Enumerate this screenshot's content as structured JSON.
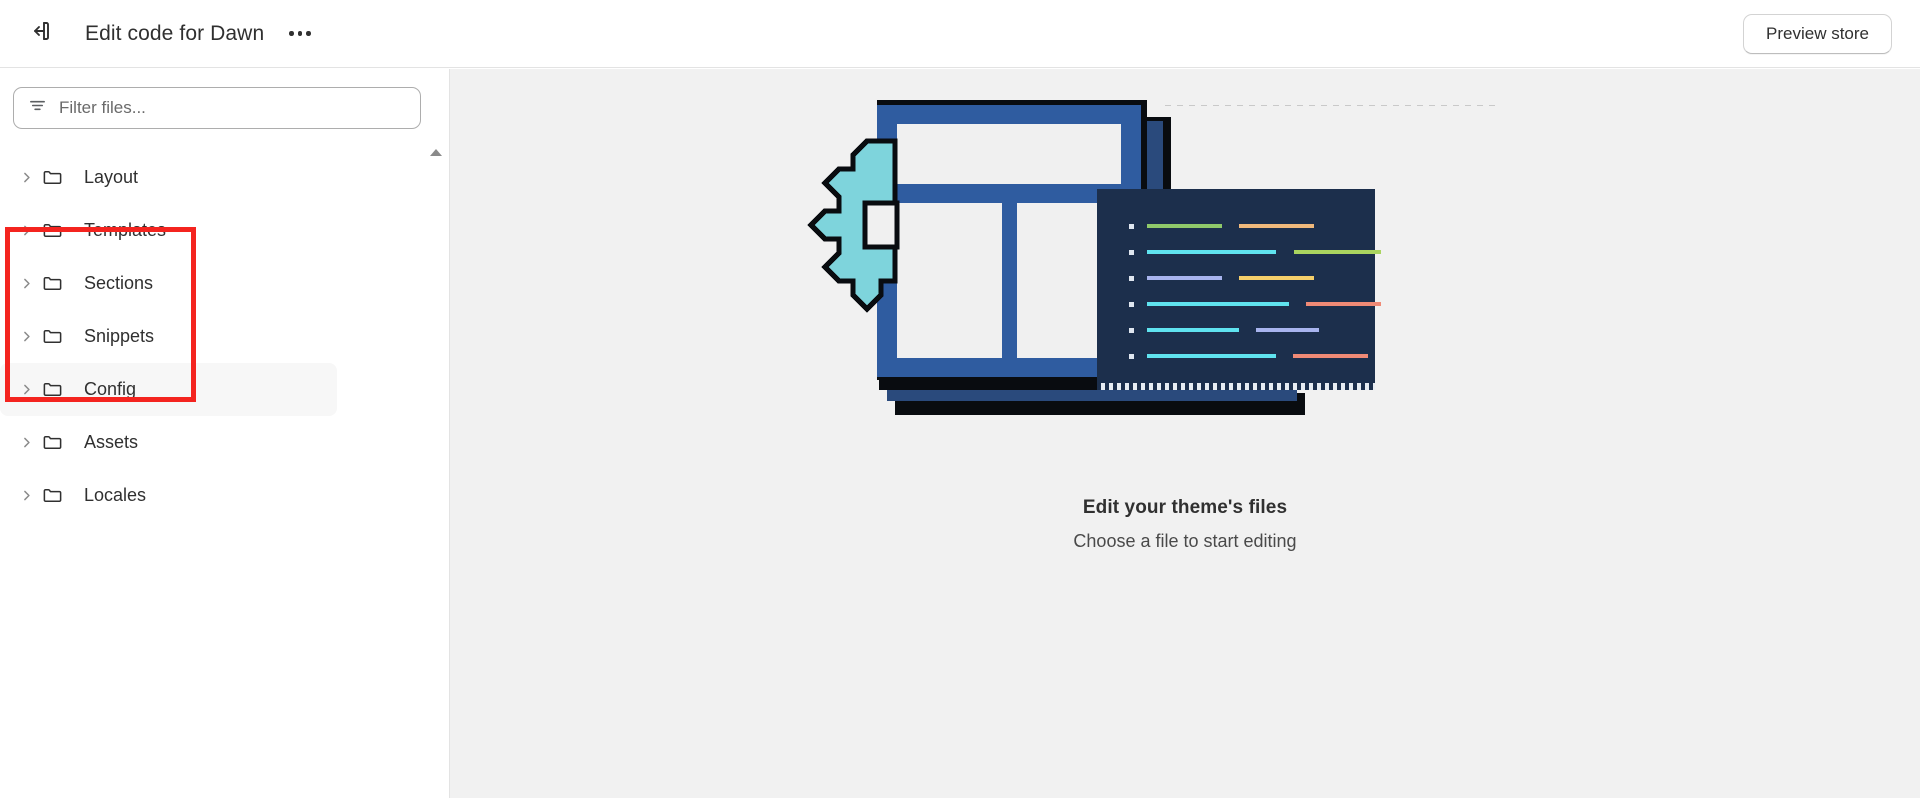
{
  "header": {
    "exit_icon": "exit-icon",
    "title": "Edit code for Dawn",
    "more_menu_icon": "ellipsis-icon",
    "preview_button": "Preview store"
  },
  "sidebar": {
    "filter": {
      "icon": "filter-icon",
      "value": "",
      "placeholder": "Filter files..."
    },
    "scrollbar_up_icon": "scroll-up-arrow-icon",
    "tree": [
      {
        "label": "Layout",
        "chevron": "chevron-right-icon",
        "icon": "folder-icon",
        "hovered": false
      },
      {
        "label": "Templates",
        "chevron": "chevron-right-icon",
        "icon": "folder-icon",
        "hovered": false
      },
      {
        "label": "Sections",
        "chevron": "chevron-right-icon",
        "icon": "folder-icon",
        "hovered": false
      },
      {
        "label": "Snippets",
        "chevron": "chevron-right-icon",
        "icon": "folder-icon",
        "hovered": false
      },
      {
        "label": "Config",
        "chevron": "chevron-right-icon",
        "icon": "folder-icon",
        "hovered": true
      },
      {
        "label": "Assets",
        "chevron": "chevron-right-icon",
        "icon": "folder-icon",
        "hovered": false
      },
      {
        "label": "Locales",
        "chevron": "chevron-right-icon",
        "icon": "folder-icon",
        "hovered": false
      }
    ]
  },
  "annotation": {
    "shape": "rectangle",
    "color": "#f4241f"
  },
  "main": {
    "illustration": "theme-files-illustration",
    "empty_state_title": "Edit your theme's files",
    "empty_state_subtitle": "Choose a file to start editing",
    "illustration_colors": {
      "window_blue": "#2f5ca0",
      "window_blue_dark": "#2a4a7c",
      "outline_black": "#090c10",
      "code_panel_navy": "#1c2f4c",
      "gear_cyan": "#7ed4dc",
      "panel_white": "#f0f0f0",
      "code_green": "#8fc96a",
      "code_tan": "#f0b97c",
      "code_cyan": "#5fe3ef",
      "code_lime": "#aad45f",
      "code_periwinkle": "#a8b4ee",
      "code_yellow": "#f5cf6a",
      "code_salmon": "#f08a76"
    },
    "code_lines": [
      {
        "bar1_color": "#8fc96a",
        "bar1_width": 75,
        "bar2_color": "#f0b97c",
        "bar2_width": 75,
        "gap": 17
      },
      {
        "bar1_color": "#5fe3ef",
        "bar1_width": 129,
        "bar2_color": "#aad45f",
        "bar2_width": 87,
        "gap": 18
      },
      {
        "bar1_color": "#a8b4ee",
        "bar1_width": 75,
        "bar2_color": "#f5cf6a",
        "bar2_width": 75,
        "gap": 17
      },
      {
        "bar1_color": "#5fe3ef",
        "bar1_width": 142,
        "bar2_color": "#f08a76",
        "bar2_width": 75,
        "gap": 17
      },
      {
        "bar1_color": "#5fe3ef",
        "bar1_width": 92,
        "bar2_color": "#a8b4ee",
        "bar2_width": 63,
        "gap": 17
      },
      {
        "bar1_color": "#5fe3ef",
        "bar1_width": 129,
        "bar2_color": "#f08a76",
        "bar2_width": 75,
        "gap": 17
      }
    ]
  }
}
